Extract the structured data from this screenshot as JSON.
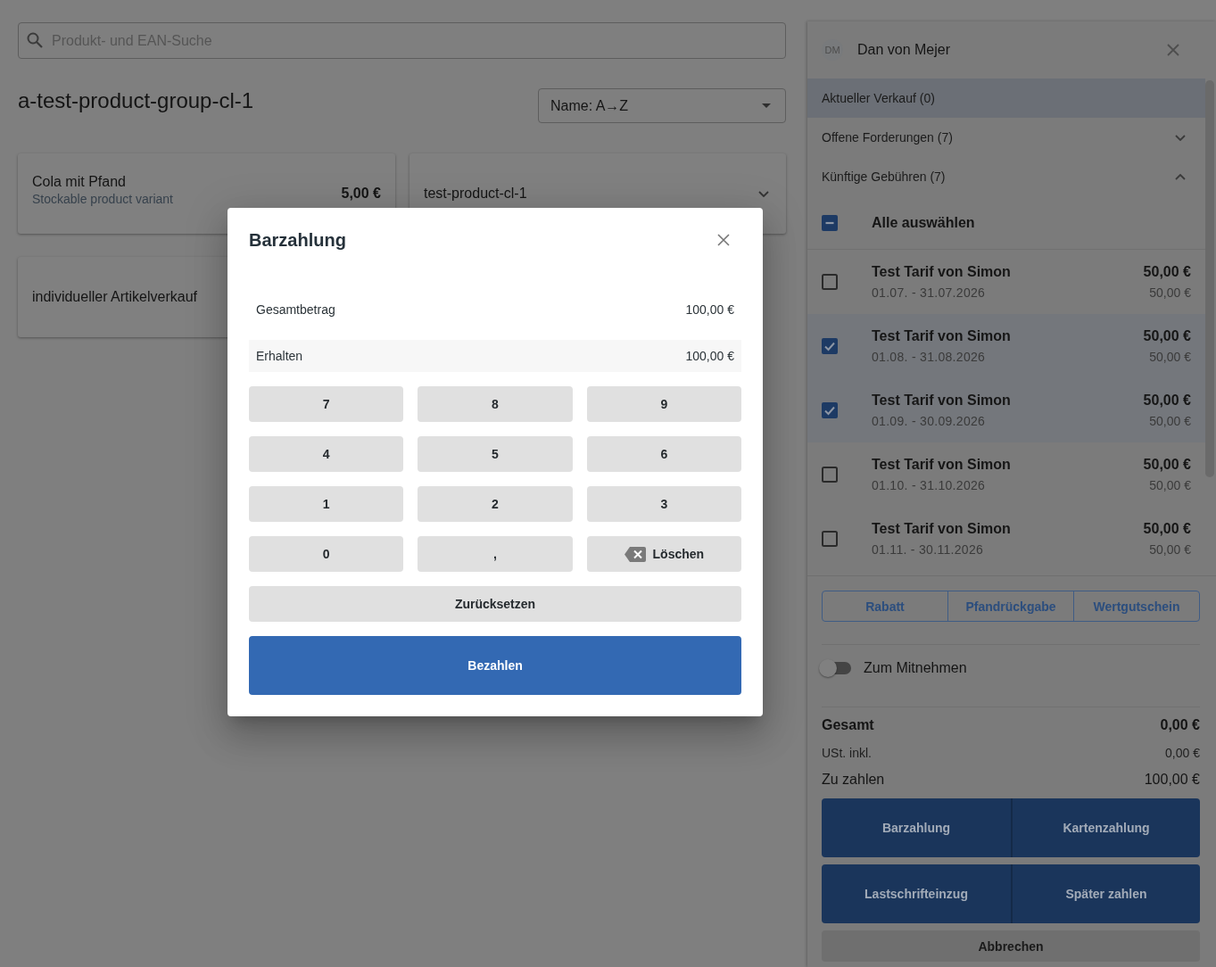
{
  "search": {
    "placeholder": "Produkt- und EAN-Suche"
  },
  "product_group": {
    "title": "a-test-product-group-cl-1",
    "sort": {
      "value": "Name: A→Z"
    }
  },
  "products": [
    {
      "kind": "variant",
      "name": "Cola mit Pfand",
      "subtitle": "Stockable product variant",
      "price": "5,00 €"
    },
    {
      "kind": "group",
      "name": "test-product-cl-1",
      "expanded": false
    },
    {
      "kind": "item",
      "name": "individueller Artikelverkauf"
    }
  ],
  "customer_panel": {
    "customer": {
      "initials": "DM",
      "name": "Dan von Mejer"
    },
    "sections": [
      {
        "label": "Aktueller Verkauf (0)",
        "selected": true
      },
      {
        "label": "Offene Forderungen (7)",
        "selected": false,
        "expanded": false
      },
      {
        "label": "Künftige Gebühren (7)",
        "selected": false,
        "expanded": true
      }
    ],
    "select_all": {
      "label": "Alle auswählen",
      "checked": false,
      "indeterminate": true
    },
    "fees": [
      {
        "title": "Test Tarif von Simon",
        "period": "01.07. - 31.07.2026",
        "price": "50,00 €",
        "net_price": "50,00 €",
        "checked": false
      },
      {
        "title": "Test Tarif von Simon",
        "period": "01.08. - 31.08.2026",
        "price": "50,00 €",
        "net_price": "50,00 €",
        "checked": true
      },
      {
        "title": "Test Tarif von Simon",
        "period": "01.09. - 30.09.2026",
        "price": "50,00 €",
        "net_price": "50,00 €",
        "checked": true
      },
      {
        "title": "Test Tarif von Simon",
        "period": "01.10. - 31.10.2026",
        "price": "50,00 €",
        "net_price": "50,00 €",
        "checked": false
      },
      {
        "title": "Test Tarif von Simon",
        "period": "01.11. - 30.11.2026",
        "price": "50,00 €",
        "net_price": "50,00 €",
        "checked": false
      }
    ],
    "adjustments": [
      {
        "label": "Rabatt"
      },
      {
        "label": "Pfandrückgabe"
      },
      {
        "label": "Wertgutschein"
      }
    ],
    "takeaway": {
      "label": "Zum Mitnehmen",
      "on": false
    },
    "totals": [
      {
        "kind": "total",
        "label": "Gesamt",
        "value": "0,00 €"
      },
      {
        "kind": "tax",
        "label": "USt. inkl.",
        "value": "0,00 €"
      },
      {
        "kind": "due",
        "label": "Zu zahlen",
        "value": "100,00 €"
      }
    ],
    "payment_methods": [
      {
        "label": "Barzahlung"
      },
      {
        "label": "Kartenzahlung"
      },
      {
        "label": "Lastschrifteinzug"
      },
      {
        "label": "Später zahlen"
      }
    ],
    "cancel": {
      "label": "Abbrechen"
    }
  },
  "dialog": {
    "title": "Barzahlung",
    "amounts": [
      {
        "kind": "total",
        "label": "Gesamtbetrag",
        "value": "100,00 €"
      },
      {
        "kind": "input",
        "label": "Erhalten",
        "value": "100,00 €"
      }
    ],
    "keys": [
      {
        "kind": "digit",
        "label": "7"
      },
      {
        "kind": "digit",
        "label": "8"
      },
      {
        "kind": "digit",
        "label": "9"
      },
      {
        "kind": "digit",
        "label": "4"
      },
      {
        "kind": "digit",
        "label": "5"
      },
      {
        "kind": "digit",
        "label": "6"
      },
      {
        "kind": "digit",
        "label": "1"
      },
      {
        "kind": "digit",
        "label": "2"
      },
      {
        "kind": "digit",
        "label": "3"
      },
      {
        "kind": "digit",
        "label": "0"
      },
      {
        "kind": "digit",
        "label": ","
      },
      {
        "kind": "delete",
        "label": "Löschen"
      }
    ],
    "reset": {
      "label": "Zurücksetzen"
    },
    "submit": {
      "label": "Bezahlen"
    }
  }
}
